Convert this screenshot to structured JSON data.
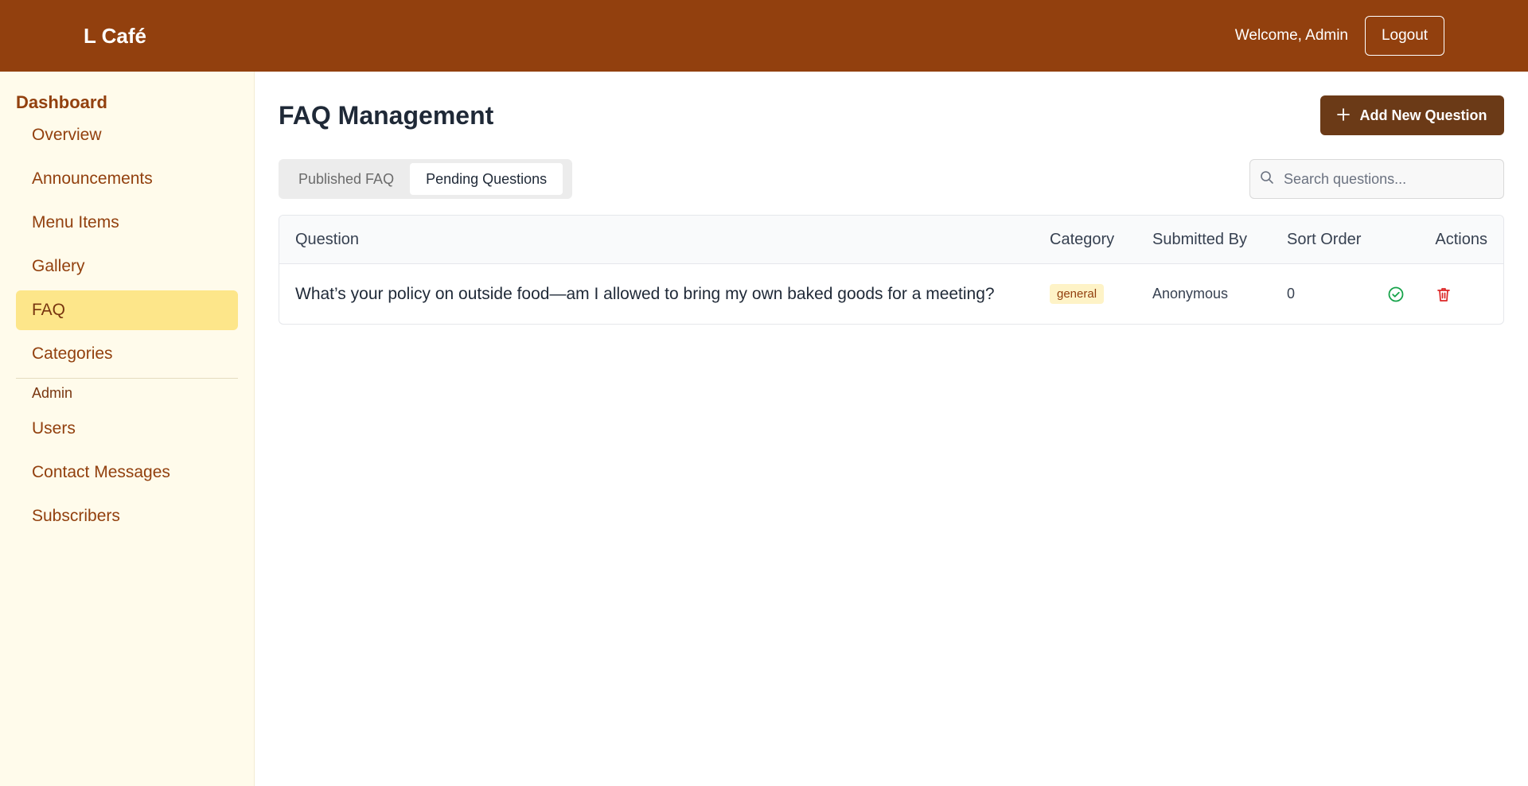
{
  "header": {
    "brand": "L Café",
    "welcome": "Welcome, Admin",
    "logout_label": "Logout",
    "bg_color": "#92400e"
  },
  "sidebar": {
    "title": "Dashboard",
    "items": [
      {
        "label": "Overview"
      },
      {
        "label": "Announcements"
      },
      {
        "label": "Menu Items"
      },
      {
        "label": "Gallery"
      },
      {
        "label": "FAQ",
        "active": true
      },
      {
        "label": "Categories"
      }
    ],
    "admin_section": "Admin",
    "admin_items": [
      {
        "label": "Users"
      },
      {
        "label": "Contact Messages"
      },
      {
        "label": "Subscribers"
      }
    ]
  },
  "main": {
    "title": "FAQ Management",
    "add_button_label": "Add New Question",
    "add_button_icon": "plus-icon",
    "tabs": [
      {
        "label": "Published FAQ",
        "active": false
      },
      {
        "label": "Pending Questions",
        "active": true
      }
    ],
    "search": {
      "placeholder": "Search questions...",
      "value": "",
      "icon": "search-icon"
    },
    "table": {
      "columns": [
        "Question",
        "Category",
        "Submitted By",
        "Sort Order",
        "Actions"
      ],
      "rows": [
        {
          "question": "What’s your policy on outside food—am I allowed to bring my own baked goods for a meeting?",
          "category": "general",
          "submitted_by": "Anonymous",
          "sort_order": "0",
          "actions": [
            "approve-icon",
            "delete-icon"
          ]
        }
      ]
    }
  },
  "colors": {
    "accent": "#92400e",
    "button": "#6b3a17",
    "sidebar_bg": "#fffbeb",
    "active_nav": "#fde68a",
    "approve": "#16a34a",
    "delete": "#dc2626"
  }
}
